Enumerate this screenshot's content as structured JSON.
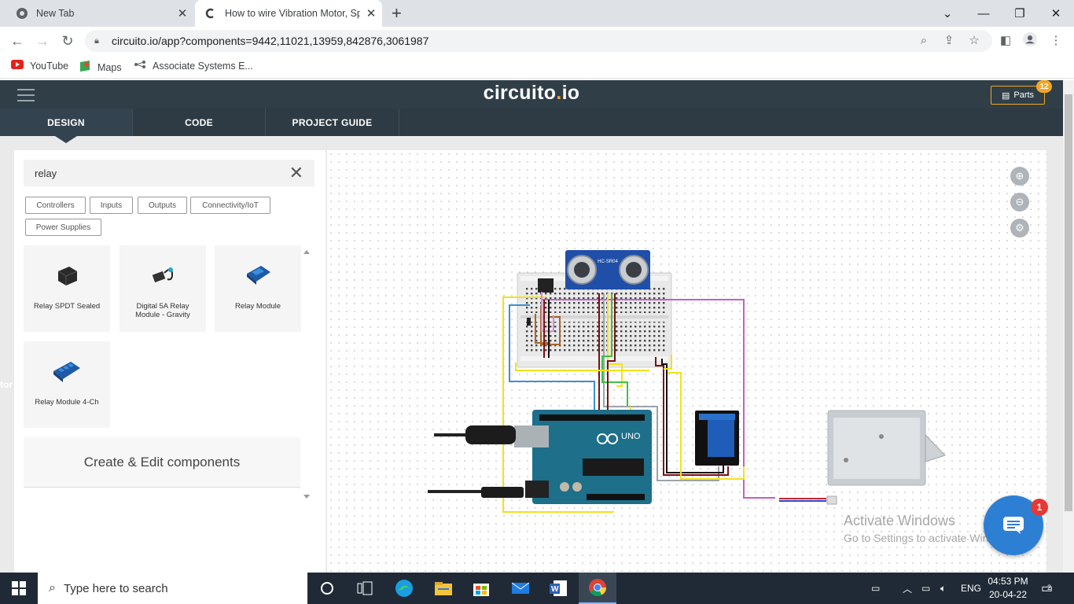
{
  "browser": {
    "tabs": [
      {
        "title": "New Tab"
      },
      {
        "title": "How to wire Vibration Motor, Sp"
      }
    ],
    "url": "circuito.io/app?components=9442,11021,13959,842876,3061987",
    "bookmarks": [
      "YouTube",
      "Maps",
      "Associate Systems E..."
    ]
  },
  "app": {
    "logo_main": "circuito",
    "logo_dot": ".",
    "logo_tail": "io",
    "parts_label": "Parts",
    "parts_count": "12",
    "tabs": [
      "DESIGN",
      "CODE",
      "PROJECT GUIDE"
    ],
    "search_value": "relay",
    "categories": [
      "Controllers",
      "Inputs",
      "Outputs",
      "Connectivity/IoT",
      "Power Supplies"
    ],
    "components": [
      {
        "label": "Relay SPDT Sealed"
      },
      {
        "label": "Digital 5A Relay Module - Gravity"
      },
      {
        "label": "Relay Module"
      },
      {
        "label": "Relay Module 4-Ch"
      }
    ],
    "create_label": "Create & Edit components",
    "side_stub": "tor",
    "board_label": "UNO",
    "sensor_label": "HC-SR04"
  },
  "overlay": {
    "activate_title": "Activate Windows",
    "activate_sub": "Go to Settings to activate Windows.",
    "chat_badge": "1"
  },
  "taskbar": {
    "search_placeholder": "Type here to search",
    "lang": "ENG",
    "time": "04:53 PM",
    "date": "20-04-22",
    "notif_count": "2"
  },
  "colors": {
    "header_bg": "#303e48",
    "accent": "#f5a623",
    "chat": "#2d7fd4"
  }
}
